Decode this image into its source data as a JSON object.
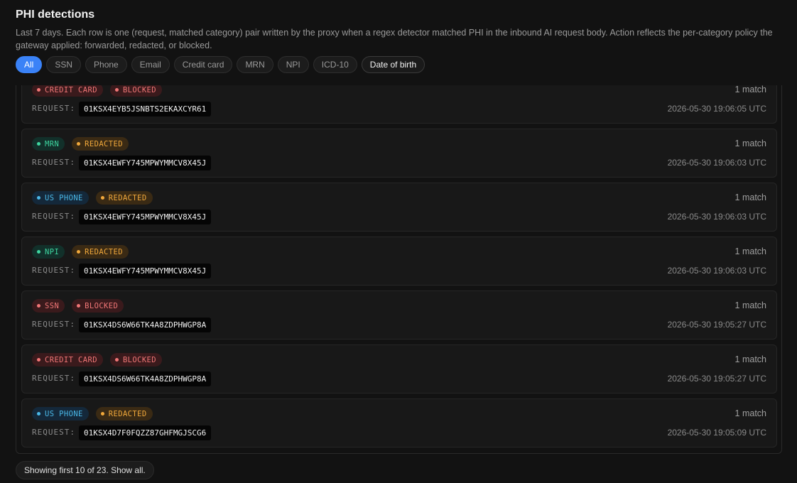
{
  "header": {
    "title": "PHI detections",
    "description": "Last 7 days. Each row is one (request, matched category) pair written by the proxy when a regex detector matched PHI in the inbound AI request body. Action reflects the per-category policy the gateway applied: forwarded, redacted, or blocked."
  },
  "filters": [
    {
      "label": "All",
      "active": true
    },
    {
      "label": "SSN",
      "active": false
    },
    {
      "label": "Phone",
      "active": false
    },
    {
      "label": "Email",
      "active": false
    },
    {
      "label": "Credit card",
      "active": false
    },
    {
      "label": "MRN",
      "active": false
    },
    {
      "label": "NPI",
      "active": false
    },
    {
      "label": "ICD-10",
      "active": false
    },
    {
      "label": "Date of birth",
      "active": false
    }
  ],
  "request_label": "REQUEST:",
  "colors": {
    "red": "#f07676",
    "red_bg": "#3a1a1c",
    "orange": "#f2a93b",
    "orange_bg": "#3a2a14",
    "green": "#3ed6a0",
    "green_bg": "#12302a",
    "cyan": "#4ab8e8",
    "cyan_bg": "#14283a",
    "accent": "#3a82f7"
  },
  "rows": [
    {
      "category": "CREDIT CARD",
      "category_color": "red",
      "action": "BLOCKED",
      "action_color": "red",
      "count": "1 match",
      "request_id": "01KSX4EYB5JSNBTS2EKAXCYR61",
      "timestamp": "2026-05-30 19:06:05 UTC"
    },
    {
      "category": "MRN",
      "category_color": "green",
      "action": "REDACTED",
      "action_color": "orange",
      "count": "1 match",
      "request_id": "01KSX4EWFY745MPWYMMCV8X45J",
      "timestamp": "2026-05-30 19:06:03 UTC"
    },
    {
      "category": "US PHONE",
      "category_color": "cyan",
      "action": "REDACTED",
      "action_color": "orange",
      "count": "1 match",
      "request_id": "01KSX4EWFY745MPWYMMCV8X45J",
      "timestamp": "2026-05-30 19:06:03 UTC"
    },
    {
      "category": "NPI",
      "category_color": "green",
      "action": "REDACTED",
      "action_color": "orange",
      "count": "1 match",
      "request_id": "01KSX4EWFY745MPWYMMCV8X45J",
      "timestamp": "2026-05-30 19:06:03 UTC"
    },
    {
      "category": "SSN",
      "category_color": "red",
      "action": "BLOCKED",
      "action_color": "red",
      "count": "1 match",
      "request_id": "01KSX4DS6W66TK4A8ZDPHWGP8A",
      "timestamp": "2026-05-30 19:05:27 UTC"
    },
    {
      "category": "CREDIT CARD",
      "category_color": "red",
      "action": "BLOCKED",
      "action_color": "red",
      "count": "1 match",
      "request_id": "01KSX4DS6W66TK4A8ZDPHWGP8A",
      "timestamp": "2026-05-30 19:05:27 UTC"
    },
    {
      "category": "US PHONE",
      "category_color": "cyan",
      "action": "REDACTED",
      "action_color": "orange",
      "count": "1 match",
      "request_id": "01KSX4D7F0FQZZ87GHFMGJSCG6",
      "timestamp": "2026-05-30 19:05:09 UTC"
    }
  ],
  "footer": {
    "show_all_label": "Showing first 10 of 23. Show all."
  }
}
